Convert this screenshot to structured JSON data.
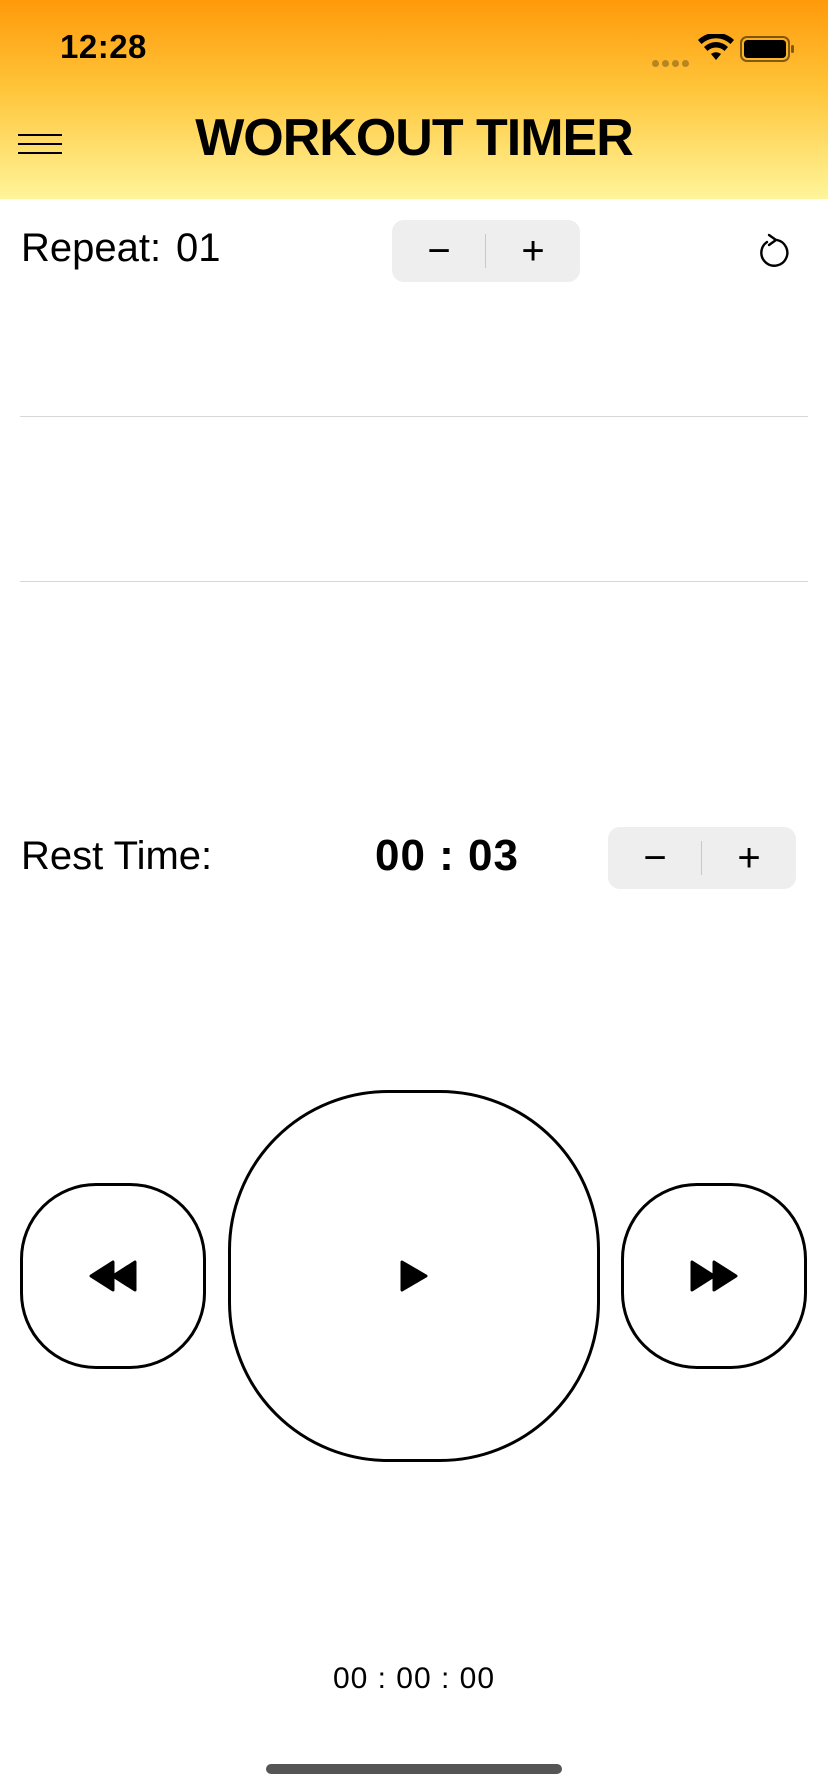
{
  "status_bar": {
    "time": "12:28"
  },
  "header": {
    "title": "WORKOUT TIMER"
  },
  "repeat": {
    "label": "Repeat:",
    "value": "01",
    "minus": "−",
    "plus": "+"
  },
  "rest": {
    "label": "Rest Time:",
    "value": "00 : 03",
    "minus": "−",
    "plus": "+"
  },
  "total_time": "00 : 00 : 00",
  "colors": {
    "header_gradient_top": "#ff9a0a",
    "header_gradient_bottom": "#fff59a",
    "stepper_bg": "#eeeeef"
  },
  "icons": [
    "menu-icon",
    "wifi-icon",
    "battery-icon",
    "reset-icon",
    "rewind-icon",
    "play-icon",
    "fast-forward-icon"
  ]
}
